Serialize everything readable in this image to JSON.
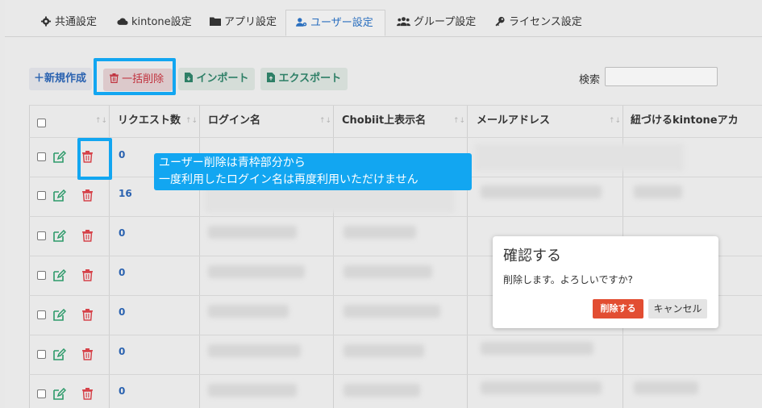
{
  "tabs": [
    {
      "label": "共通設定",
      "icon": "gear-icon"
    },
    {
      "label": "kintone設定",
      "icon": "cloud-icon"
    },
    {
      "label": "アプリ設定",
      "icon": "folder-icon"
    },
    {
      "label": "ユーザー設定",
      "icon": "user-gear-icon",
      "active": true
    },
    {
      "label": "グループ設定",
      "icon": "users-icon"
    },
    {
      "label": "ライセンス設定",
      "icon": "key-icon"
    }
  ],
  "toolbar": {
    "new_label": "＋新規作成",
    "bulk_delete_label": "一括削除",
    "import_label": "インポート",
    "export_label": "エクスポート",
    "search_label": "検索",
    "search_value": ""
  },
  "table": {
    "columns": [
      "リクエスト数",
      "ログイン名",
      "Chobiit上表示名",
      "メールアドレス",
      "紐づけるkintoneアカ"
    ],
    "rows": [
      {
        "requests": "0"
      },
      {
        "requests": "16"
      },
      {
        "requests": "0"
      },
      {
        "requests": "0"
      },
      {
        "requests": "0"
      },
      {
        "requests": "0"
      },
      {
        "requests": "0"
      }
    ]
  },
  "annotation": {
    "line1": "ユーザー削除は青枠部分から",
    "line2": "一度利用したログイン名は再度利用いただけません"
  },
  "dialog": {
    "title": "確認する",
    "message": "削除します。よろしいですか?",
    "confirm_label": "削除する",
    "cancel_label": "キャンセル"
  },
  "colors": {
    "highlight": "#12a6f1",
    "link_blue": "#2a62b0",
    "danger": "#e24d32",
    "edit_green": "#2d9a6a"
  }
}
